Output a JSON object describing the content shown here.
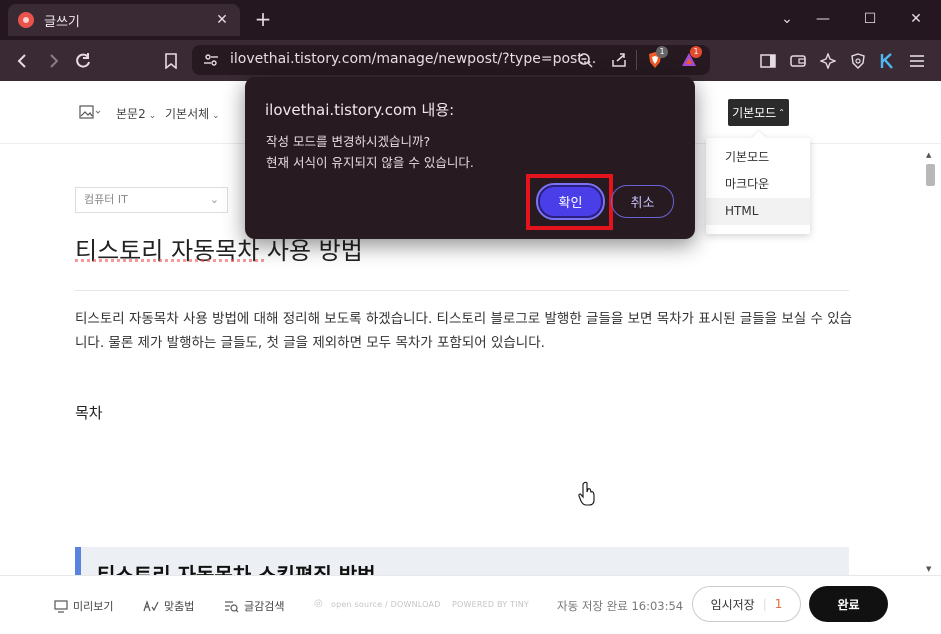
{
  "browser": {
    "tab_title": "글쓰기",
    "url": "ilovethai.tistory.com/manage/newpost/?type=post...",
    "shield_badge": "1",
    "rewards_badge": "1"
  },
  "editor_toolbar": {
    "paragraph_style": "본문2",
    "font": "기본서체",
    "mode_button": "기본모드",
    "mode_options": [
      "기본모드",
      "마크다운",
      "HTML"
    ]
  },
  "post": {
    "category": "컴퓨터 IT",
    "title": "티스토리 자동목차 사용 방법",
    "paragraph": "티스토리 자동목차 사용 방법에 대해 정리해 보도록 하겠습니다. 티스토리 블로그로 발행한 글들을 보면 목차가 표시된 글들을 보실 수 있습니다. 물론 제가 발행하는 글들도, 첫 글을 제외하면 모두 목차가 포함되어 있습니다.",
    "toc_label": "목차",
    "heading": "티스토리 자동목차 스킨편집 방법"
  },
  "bottom_bar": {
    "preview": "미리보기",
    "spellcheck": "맞춤법",
    "search": "글감검색",
    "open_source": "open source / DOWNLOAD",
    "powered_by": "POWERED BY TINY",
    "autosave": "자동 저장 완료 16:03:54",
    "draft_label": "임시저장",
    "draft_count": "1",
    "done_label": "완료"
  },
  "dialog": {
    "title": "ilovethai.tistory.com 내용:",
    "message_line1": "작성 모드를 변경하시겠습니까?",
    "message_line2": "현재 서식이 유지되지 않을 수 있습니다.",
    "confirm_label": "확인",
    "cancel_label": "취소"
  },
  "colors": {
    "browser_frame": "#25171f",
    "toolbar": "#3a2a33",
    "dialog_bg": "#271a21",
    "confirm_button": "#4a3ee8",
    "highlight_box": "#e3141b",
    "heading_accent": "#5a83e0"
  }
}
